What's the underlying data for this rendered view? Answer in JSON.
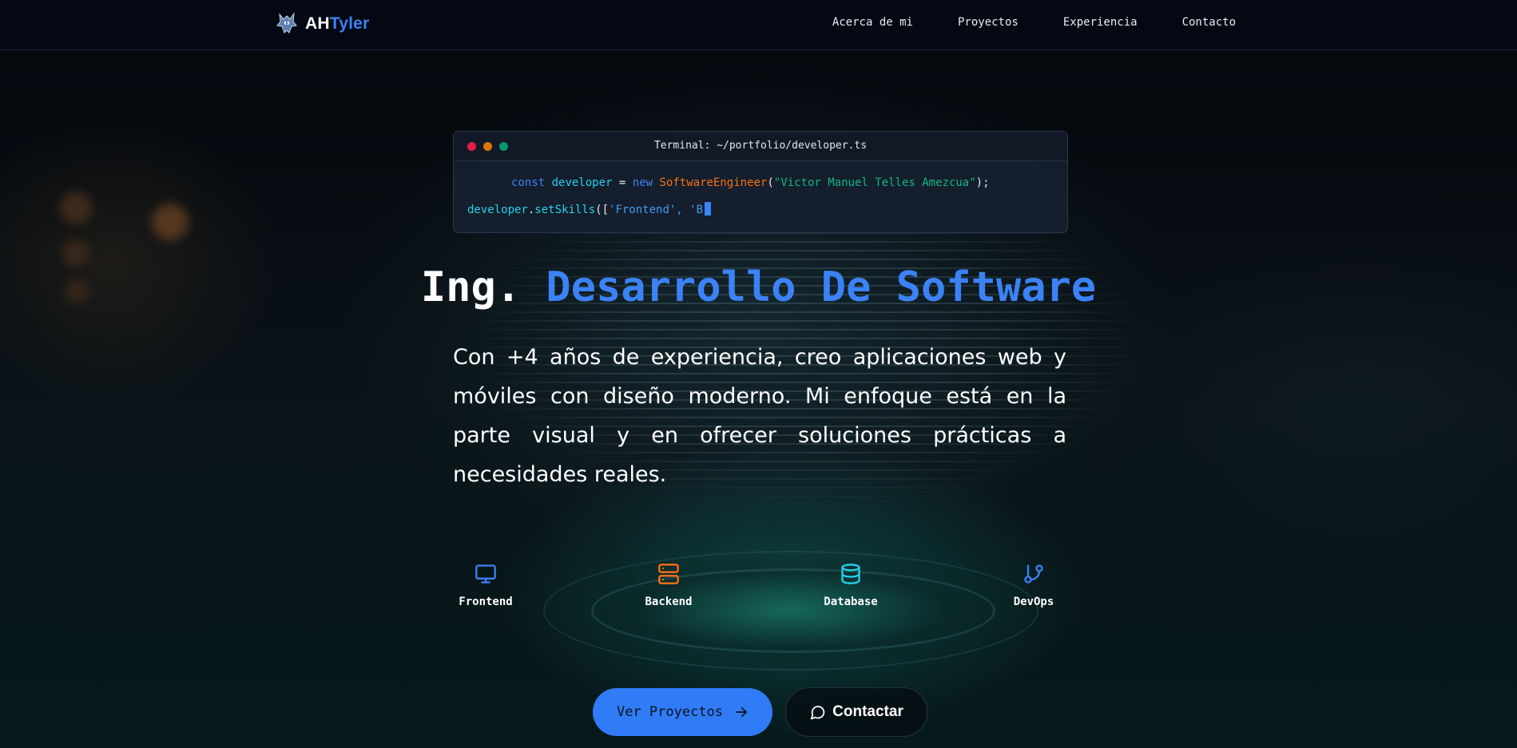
{
  "brand": {
    "name_part1": "AH",
    "name_part2": "Tyler",
    "logo_icon": "wolf-logo-icon"
  },
  "nav": {
    "items": [
      {
        "label": "Acerca de mi"
      },
      {
        "label": "Proyectos"
      },
      {
        "label": "Experiencia"
      },
      {
        "label": "Contacto"
      }
    ]
  },
  "terminal": {
    "title": "Terminal: ~/portfolio/developer.ts",
    "line1": {
      "keyword": "const",
      "variable": "developer",
      "operator": "=",
      "new_keyword": "new",
      "class_name": "SoftwareEngineer",
      "open_paren": "(",
      "argument": "\"Victor Manuel Telles Amezcua\"",
      "close": ");"
    },
    "line2": {
      "object": "developer",
      "dot": ".",
      "method": "setSkills",
      "open": "([",
      "args": "'Frontend', 'B"
    }
  },
  "hero": {
    "title_part1": "Ing.",
    "title_part2": "Desarrollo De Software",
    "description": "Con +4 años de experiencia, creo aplicaciones web y móviles con diseño moderno. Mi enfoque está en la parte visual y en ofrecer soluciones prácticas a necesidades reales."
  },
  "skills": [
    {
      "label": "Frontend",
      "icon": "monitor-icon",
      "color": "#3b82f6"
    },
    {
      "label": "Backend",
      "icon": "server-icon",
      "color": "#f97316"
    },
    {
      "label": "Database",
      "icon": "database-icon",
      "color": "#22d3ee"
    },
    {
      "label": "DevOps",
      "icon": "git-branch-icon",
      "color": "#3b82f6"
    }
  ],
  "buttons": {
    "primary": {
      "label": "Ver Proyectos",
      "icon": "arrow-right-icon"
    },
    "secondary": {
      "label": "Contactar",
      "icon": "message-circle-icon"
    }
  },
  "colors": {
    "accent": "#3b82f6",
    "background": "#05070d",
    "nav_background": "#040813"
  }
}
